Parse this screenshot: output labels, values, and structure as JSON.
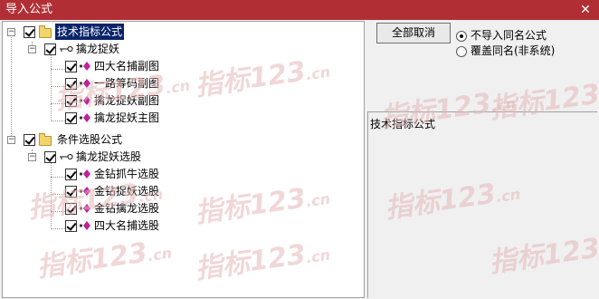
{
  "window": {
    "title": "导入公式",
    "close_glyph": "✕"
  },
  "tree": {
    "groups": [
      {
        "label": "技术指标公式",
        "expander": "−",
        "sub": {
          "label": "擒龙捉妖",
          "expander": "−",
          "items": [
            "四大名捕副图",
            "一路筹码副图",
            "擒龙捉妖副图",
            "擒龙捉妖主图"
          ]
        }
      },
      {
        "label": "条件选股公式",
        "expander": "−",
        "sub": {
          "label": "擒龙捉妖选股",
          "expander": "−",
          "items": [
            "金钻抓牛选股",
            "金钻捉妖选股",
            "金钻擒龙选股",
            "四大名捕选股"
          ]
        }
      }
    ]
  },
  "buttons": {
    "cancel_all": "全部取消"
  },
  "options": {
    "radios": [
      {
        "label": "不导入同名公式",
        "selected": true
      },
      {
        "label": "覆盖同名(非系统)",
        "selected": false
      }
    ]
  },
  "description": {
    "text": "技术指标公式"
  },
  "watermark": {
    "main": "指标123",
    "suffix": ".cn"
  },
  "colors": {
    "titlebar": "#b22e35",
    "selection": "#0a246a",
    "watermark": "#e6b8b8"
  }
}
